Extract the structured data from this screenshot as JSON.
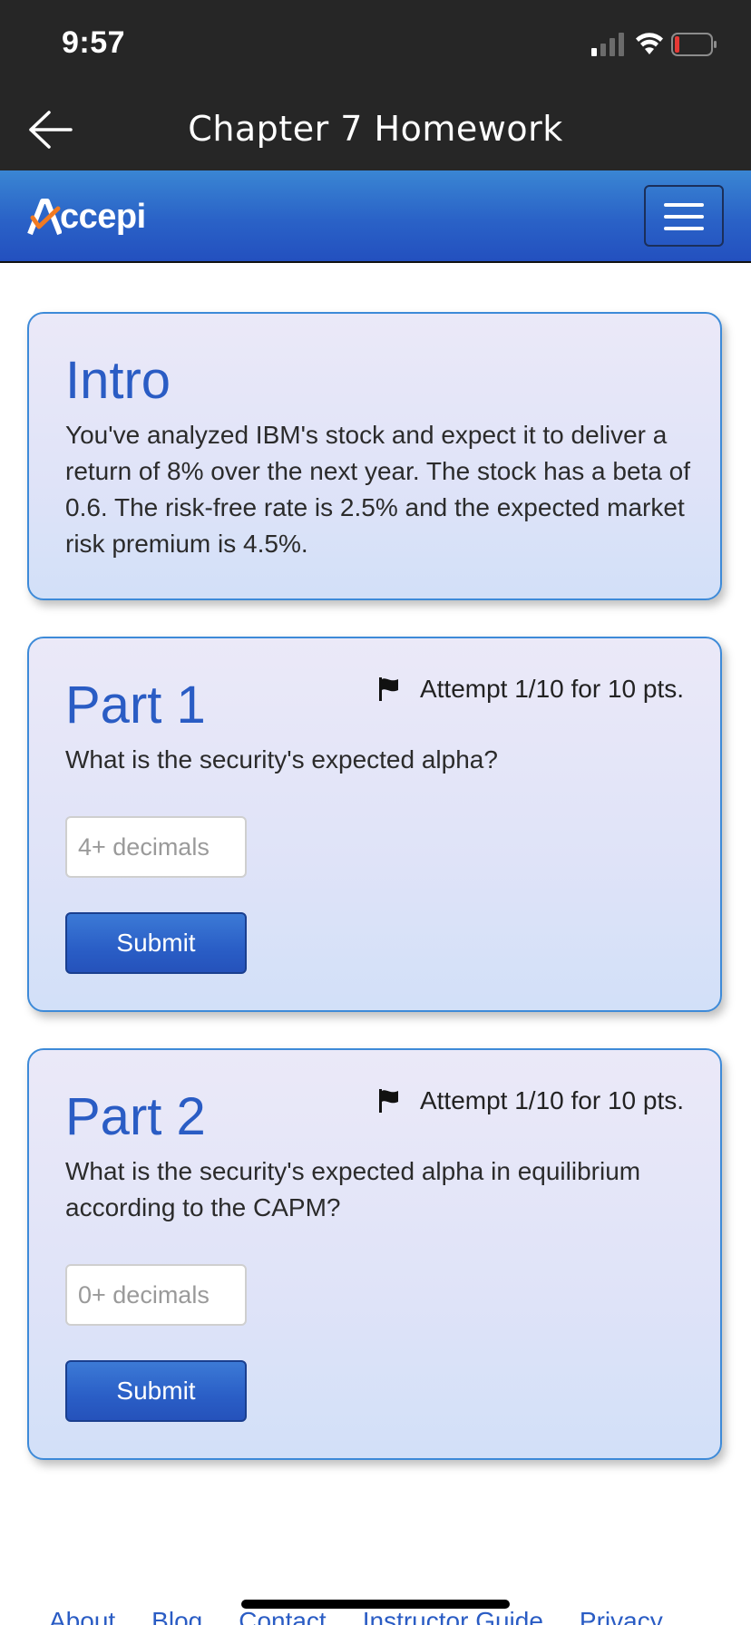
{
  "status_bar": {
    "time": "9:57",
    "battery_color": "#e53935"
  },
  "header": {
    "title": "Chapter 7 Homework"
  },
  "brand": {
    "name": "Accepi",
    "accent_color": "#f07a22"
  },
  "intro": {
    "title": "Intro",
    "text": "You've analyzed IBM's stock and expect it to deliver a return of 8% over the next year. The stock has a beta of 0.6. The risk-free rate is 2.5% and the expected market risk premium is 4.5%."
  },
  "parts": [
    {
      "title": "Part 1",
      "attempt": "Attempt 1/10 for 10 pts.",
      "question": "What is the security's expected alpha?",
      "input_placeholder": "4+ decimals",
      "input_value": "",
      "submit_label": "Submit"
    },
    {
      "title": "Part 2",
      "attempt": "Attempt 1/10 for 10 pts.",
      "question": "What is the security's expected alpha in equilibrium according to the CAPM?",
      "input_placeholder": "0+ decimals",
      "input_value": "",
      "submit_label": "Submit"
    }
  ],
  "footer": {
    "links": [
      "About",
      "Blog",
      "Contact",
      "Instructor Guide",
      "Privacy"
    ]
  },
  "colors": {
    "brand_blue": "#2a5cc4",
    "header_dark": "#262626",
    "card_border": "#3d8ad8"
  }
}
